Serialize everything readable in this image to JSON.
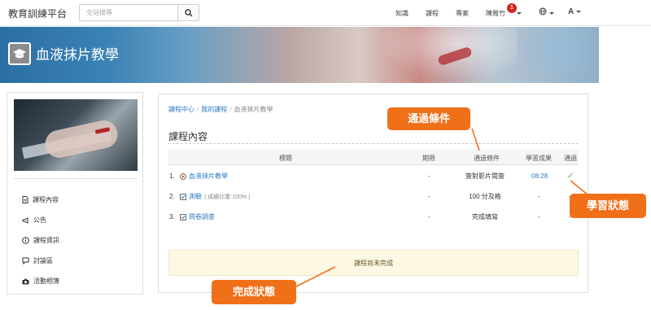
{
  "header": {
    "brand": "教育訓練平台",
    "search_placeholder": "全站搜尋",
    "nav": [
      "知識",
      "課程",
      "專案"
    ],
    "user_name": "陳雅竹",
    "notification_count": "1",
    "font_size_label": "A"
  },
  "banner": {
    "title": "血液抹片教學"
  },
  "sidebar": {
    "items": [
      {
        "label": "課程內容",
        "icon": "document-icon"
      },
      {
        "label": "公告",
        "icon": "megaphone-icon"
      },
      {
        "label": "課程資訊",
        "icon": "info-icon"
      },
      {
        "label": "討論區",
        "icon": "comment-icon"
      },
      {
        "label": "活動相簿",
        "icon": "camera-icon"
      }
    ]
  },
  "main": {
    "breadcrumb": [
      "課程中心",
      "我的課程",
      "血液抹片教學"
    ],
    "section_title": "課程內容",
    "columns": [
      "標題",
      "期限",
      "通過條件",
      "學習成果",
      "通過"
    ],
    "rows": [
      {
        "index": "1.",
        "title": "血液抹片教學",
        "deadline": "-",
        "condition": "簽對影片閱簽",
        "result": "08:28",
        "passed": "✓",
        "icon": "video-icon"
      },
      {
        "index": "2.",
        "title": "測驗",
        "note": "( 成績比重:100% )",
        "deadline": "-",
        "condition": "100 分及格",
        "result": "-",
        "passed": "-",
        "icon": "checkbox-icon"
      },
      {
        "index": "3.",
        "title": "問卷調查",
        "deadline": "-",
        "condition": "完成填寫",
        "result": "-",
        "passed": "-",
        "icon": "checkbox-icon"
      }
    ],
    "status_message": "課程尚未完成"
  },
  "callouts": {
    "pass_condition": "通過條件",
    "learning_status": "學習狀態",
    "completion_status": "完成狀態"
  },
  "colors": {
    "accent": "#f07019",
    "link": "#2f7ac0",
    "check": "#5cb85c",
    "badge": "#d9241f"
  }
}
